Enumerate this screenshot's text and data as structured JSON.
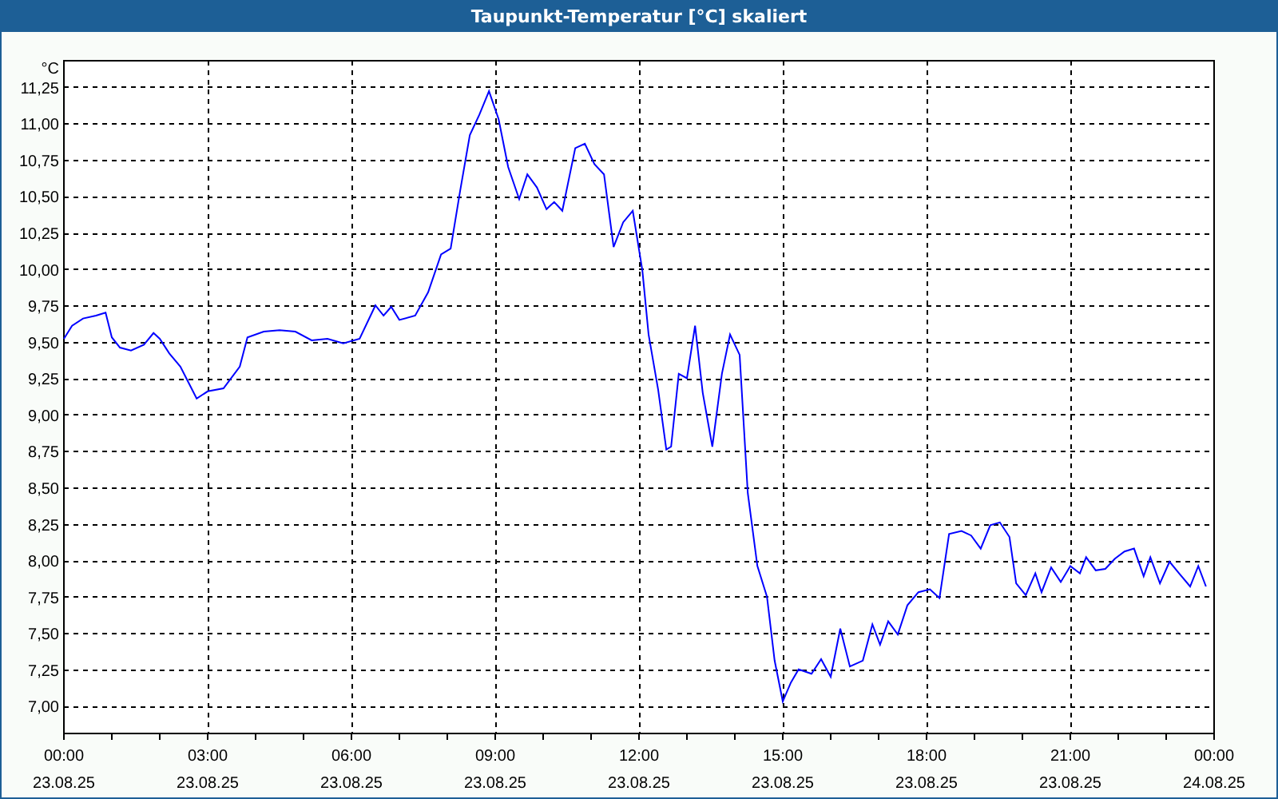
{
  "window": {
    "title": "Taupunkt-Temperatur [°C] skaliert"
  },
  "chart": {
    "chart_data": {
      "type": "line",
      "grid": true,
      "ylabel": "°C",
      "xlim": [
        0,
        24
      ],
      "ylim": [
        6.81,
        11.43
      ],
      "x": [
        0,
        0.17,
        0.4,
        0.67,
        0.87,
        1,
        1.17,
        1.4,
        1.67,
        1.87,
        2,
        2.2,
        2.43,
        2.6,
        2.77,
        3,
        3.33,
        3.67,
        3.83,
        4.17,
        4.5,
        4.83,
        5.17,
        5.5,
        5.83,
        6.17,
        6.5,
        6.67,
        6.83,
        7,
        7.33,
        7.6,
        7.87,
        8.07,
        8.27,
        8.47,
        8.67,
        8.87,
        9.07,
        9.27,
        9.5,
        9.67,
        9.87,
        10.07,
        10.23,
        10.4,
        10.67,
        10.87,
        11.07,
        11.27,
        11.47,
        11.67,
        11.87,
        12.07,
        12.2,
        12.4,
        12.57,
        12.67,
        12.83,
        13,
        13.17,
        13.33,
        13.53,
        13.73,
        13.9,
        14.1,
        14.27,
        14.47,
        14.67,
        14.83,
        15,
        15.17,
        15.33,
        15.6,
        15.8,
        16,
        16.2,
        16.4,
        16.67,
        16.87,
        17.03,
        17.2,
        17.4,
        17.6,
        17.83,
        18.07,
        18.27,
        18.47,
        18.73,
        18.93,
        19.13,
        19.33,
        19.53,
        19.73,
        19.87,
        20.07,
        20.27,
        20.4,
        20.6,
        20.8,
        21,
        21.2,
        21.33,
        21.53,
        21.73,
        21.93,
        22.13,
        22.33,
        22.53,
        22.67,
        22.87,
        23.07,
        23.27,
        23.5,
        23.67,
        23.83
      ],
      "series": [
        {
          "color": "#0000ff",
          "values": [
            9.52,
            9.61,
            9.66,
            9.68,
            9.7,
            9.53,
            9.46,
            9.44,
            9.48,
            9.56,
            9.52,
            9.42,
            9.33,
            9.22,
            9.11,
            9.16,
            9.18,
            9.33,
            9.53,
            9.57,
            9.58,
            9.57,
            9.51,
            9.52,
            9.49,
            9.52,
            9.75,
            9.68,
            9.74,
            9.65,
            9.68,
            9.84,
            10.1,
            10.14,
            10.54,
            10.92,
            11.06,
            11.22,
            11.03,
            10.7,
            10.48,
            10.65,
            10.56,
            10.41,
            10.46,
            10.4,
            10.83,
            10.86,
            10.72,
            10.65,
            10.15,
            10.32,
            10.4,
            9.99,
            9.55,
            9.17,
            8.76,
            8.78,
            9.28,
            9.25,
            9.61,
            9.15,
            8.78,
            9.28,
            9.55,
            9.41,
            8.46,
            7.96,
            7.75,
            7.31,
            7.03,
            7.16,
            7.25,
            7.22,
            7.32,
            7.2,
            7.53,
            7.27,
            7.31,
            7.56,
            7.42,
            7.58,
            7.49,
            7.69,
            7.78,
            7.8,
            7.74,
            8.18,
            8.2,
            8.17,
            8.08,
            8.24,
            8.26,
            8.16,
            7.84,
            7.76,
            7.91,
            7.78,
            7.95,
            7.85,
            7.96,
            7.91,
            8.02,
            7.93,
            7.94,
            8.01,
            8.06,
            8.08,
            7.89,
            8.02,
            7.84,
            7.99,
            7.91,
            7.82,
            7.96,
            7.82
          ]
        }
      ],
      "xticks": [
        {
          "value": 0,
          "label": "00:00"
        },
        {
          "value": 3,
          "label": "03:00"
        },
        {
          "value": 6,
          "label": "06:00"
        },
        {
          "value": 9,
          "label": "09:00"
        },
        {
          "value": 12,
          "label": "12:00"
        },
        {
          "value": 15,
          "label": "15:00"
        },
        {
          "value": 18,
          "label": "18:00"
        },
        {
          "value": 21,
          "label": "21:00"
        },
        {
          "value": 24,
          "label": "00:00"
        }
      ],
      "yticks": [
        {
          "value": 7,
          "label": "7,00"
        },
        {
          "value": 7.25,
          "label": "7,25"
        },
        {
          "value": 7.5,
          "label": "7,50"
        },
        {
          "value": 7.75,
          "label": "7,75"
        },
        {
          "value": 8,
          "label": "8,00"
        },
        {
          "value": 8.25,
          "label": "8,25"
        },
        {
          "value": 8.5,
          "label": "8,50"
        },
        {
          "value": 8.75,
          "label": "8,75"
        },
        {
          "value": 9,
          "label": "9,00"
        },
        {
          "value": 9.25,
          "label": "9,25"
        },
        {
          "value": 9.5,
          "label": "9,50"
        },
        {
          "value": 9.75,
          "label": "9,75"
        },
        {
          "value": 10,
          "label": "10,00"
        },
        {
          "value": 10.25,
          "label": "10,25"
        },
        {
          "value": 10.5,
          "label": "10,50"
        },
        {
          "value": 10.75,
          "label": "10,75"
        },
        {
          "value": 11,
          "label": "11,00"
        },
        {
          "value": 11.25,
          "label": "11,25"
        }
      ]
    },
    "date_labels": [
      "23.08.25",
      "23.08.25",
      "23.08.25",
      "23.08.25",
      "23.08.25",
      "23.08.25",
      "23.08.25",
      "23.08.25",
      "24.08.25"
    ]
  }
}
